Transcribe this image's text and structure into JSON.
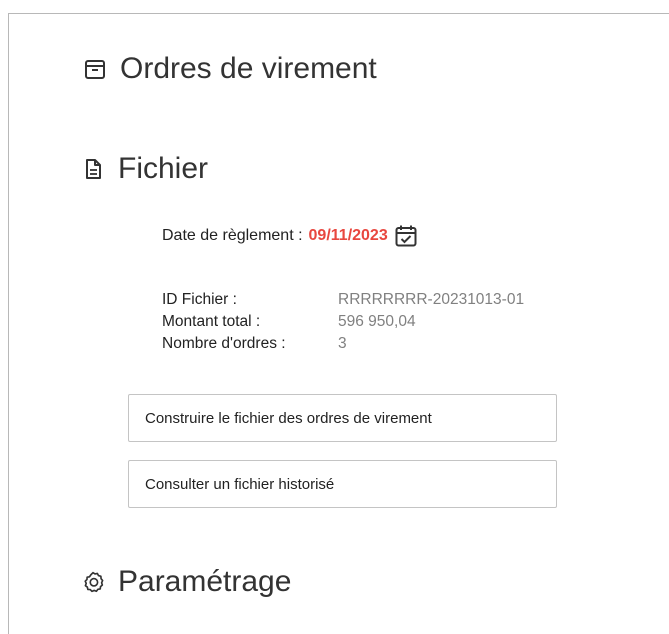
{
  "sections": {
    "ordres": {
      "title": "Ordres de virement",
      "icon": "archive-box-icon"
    },
    "fichier": {
      "title": "Fichier",
      "icon": "document-icon"
    },
    "parametrage": {
      "title": "Paramétrage",
      "icon": "gear-icon"
    }
  },
  "fichier": {
    "date_label": "Date de règlement :",
    "date_value": "09/11/2023",
    "date_icon": "calendar-check-icon",
    "info": [
      {
        "label": "ID Fichier :",
        "value": "RRRRRRRR-20231013-01"
      },
      {
        "label": "Montant total :",
        "value": "596 950,04"
      },
      {
        "label": "Nombre d'ordres :",
        "value": "3"
      }
    ],
    "buttons": {
      "build": "Construire le fichier des ordres de virement",
      "consult": "Consulter un fichier historisé"
    }
  },
  "colors": {
    "accent_red": "#e8473f",
    "value_gray": "#808080",
    "border": "#c4c4c4"
  }
}
